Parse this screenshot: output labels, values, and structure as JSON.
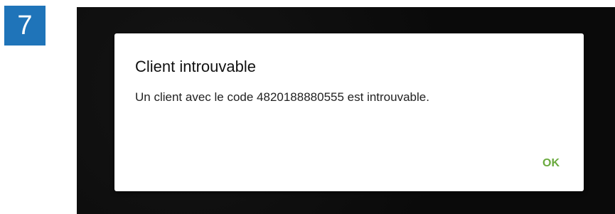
{
  "step_badge": {
    "number": "7",
    "color": "#1f74b9"
  },
  "dialog": {
    "title": "Client introuvable",
    "message": "Un client avec le code 4820188880555 est introuvable.",
    "ok_label": "OK",
    "ok_color": "#6aaa3e"
  }
}
